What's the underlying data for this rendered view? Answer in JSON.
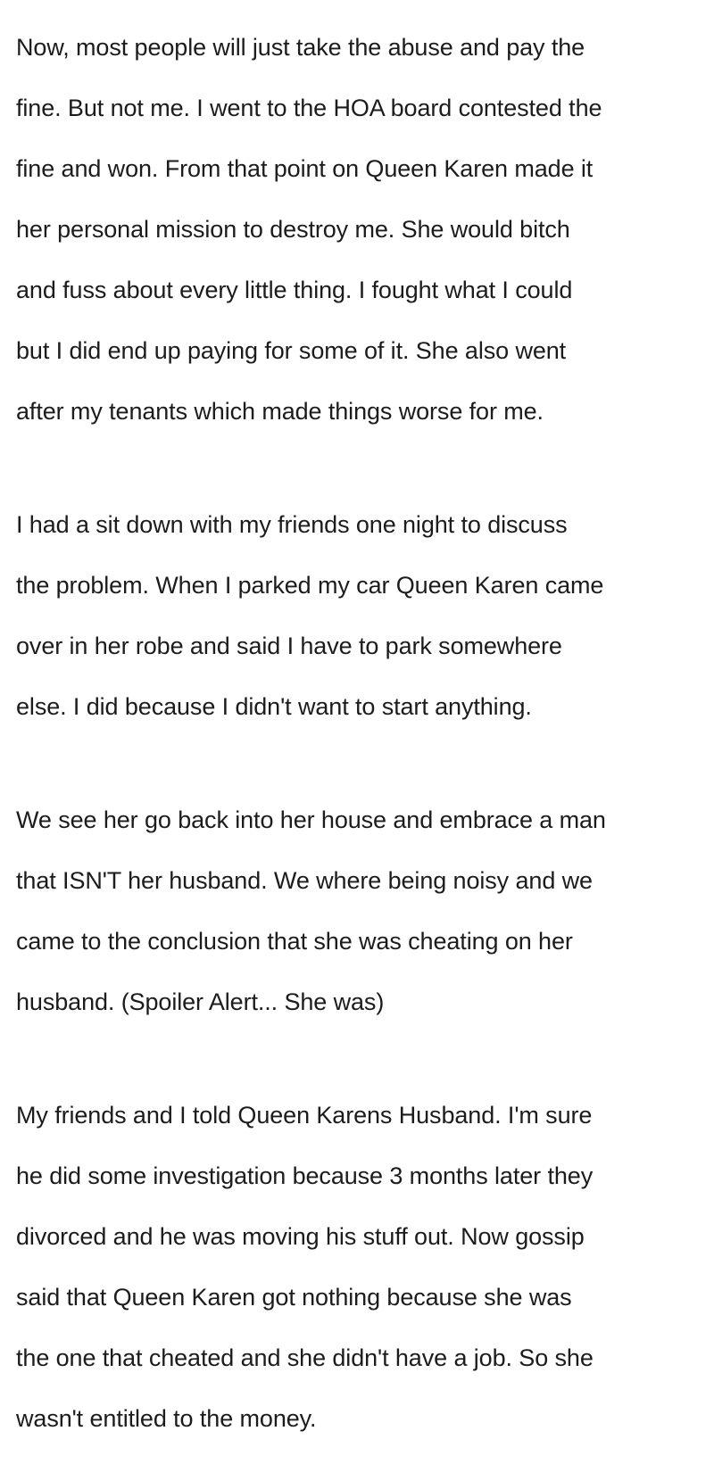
{
  "paragraphs": [
    {
      "lines": [
        "Now, most people will just take the abuse and pay the",
        "fine. But not me. I went to the HOA board contested the",
        "fine and won. From that point on Queen Karen made it",
        "her personal mission to destroy me. She would bitch",
        "and fuss about every little thing. I fought what I could",
        "but I did end up paying for some of it. She also went",
        "after my tenants which made things worse for me."
      ]
    },
    {
      "lines": [
        "I had a sit down with my friends one night to discuss",
        "the problem. When I parked my car Queen Karen came",
        "over in her robe and said  I have to park somewhere",
        "else. I did because I didn't want to start anything."
      ]
    },
    {
      "lines": [
        "We see her go back into her house and embrace a man",
        "that ISN'T her husband. We where being noisy and we",
        "came to the conclusion that she was cheating on her",
        "husband. (Spoiler Alert... She was)"
      ]
    },
    {
      "lines": [
        "My friends and I told Queen Karens Husband. I'm sure",
        "he did some investigation because 3 months later they",
        "divorced and he was moving his stuff out.  Now gossip",
        "said that Queen Karen got nothing because she was",
        "the one that cheated and she didn't have a job. So she",
        "wasn't entitled to the money."
      ]
    }
  ]
}
